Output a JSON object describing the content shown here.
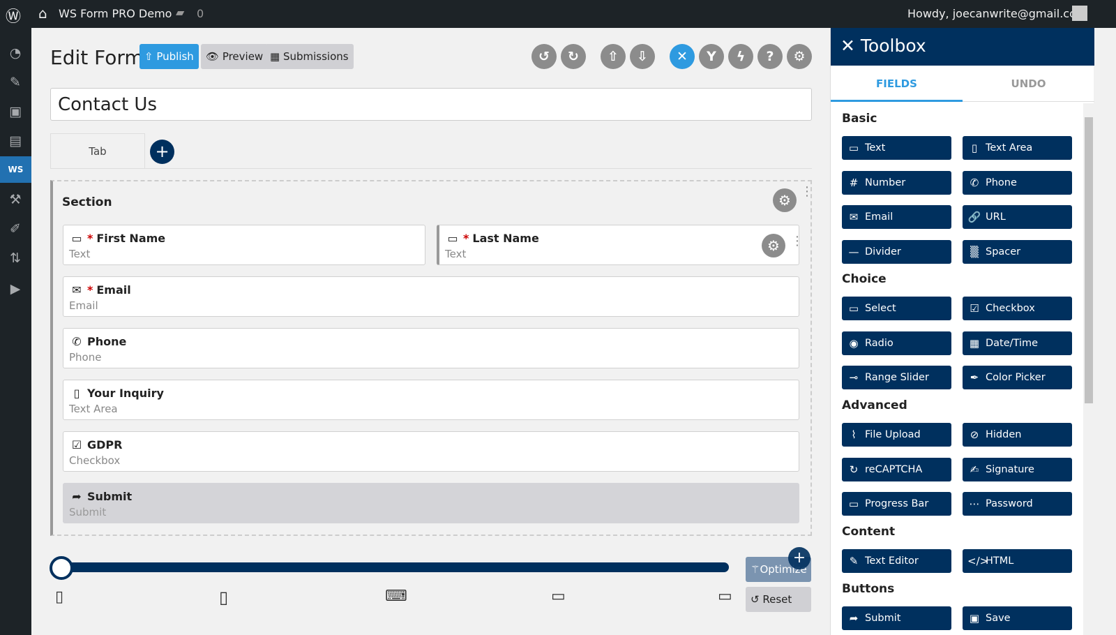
{
  "topbar": {
    "site": "WS Form PRO Demo",
    "comments": "0",
    "howdy": "Howdy, joecanwrite@gmail.com"
  },
  "sidebar": {
    "active_label": "WS"
  },
  "header": {
    "title": "Edit Form",
    "publish": "Publish",
    "preview": "Preview",
    "submissions": "Submissions"
  },
  "toolbar_icons": [
    "undo-icon",
    "redo-icon",
    "upload-icon",
    "download-icon",
    "tools-icon",
    "fork-icon",
    "bolt-icon",
    "help-icon",
    "gear-icon"
  ],
  "form": {
    "name": "Contact Us",
    "tab": "Tab",
    "section": "Section",
    "fields": [
      {
        "label": "First Name",
        "type": "Text",
        "required": true
      },
      {
        "label": "Last Name",
        "type": "Text",
        "required": true
      },
      {
        "label": "Email",
        "type": "Email",
        "required": true
      },
      {
        "label": "Phone",
        "type": "Phone",
        "required": false
      },
      {
        "label": "Your Inquiry",
        "type": "Text Area",
        "required": false
      },
      {
        "label": "GDPR",
        "type": "Checkbox",
        "required": false
      },
      {
        "label": "Submit",
        "type": "Submit",
        "required": false
      }
    ]
  },
  "breakpoints": {
    "slider_value": 0,
    "optimize": "Optimize",
    "reset": "Reset"
  },
  "toolbox": {
    "title": "Toolbox",
    "tabs": [
      "FIELDS",
      "UNDO"
    ],
    "active_tab": "FIELDS",
    "groups": [
      {
        "name": "Basic",
        "items": [
          "Text",
          "Text Area",
          "Number",
          "Phone",
          "Email",
          "URL",
          "Divider",
          "Spacer"
        ]
      },
      {
        "name": "Choice",
        "items": [
          "Select",
          "Checkbox",
          "Radio",
          "Date/Time",
          "Range Slider",
          "Color Picker"
        ]
      },
      {
        "name": "Advanced",
        "items": [
          "File Upload",
          "Hidden",
          "reCAPTCHA",
          "Signature",
          "Progress Bar",
          "Password"
        ]
      },
      {
        "name": "Content",
        "items": [
          "Text Editor",
          "HTML"
        ]
      },
      {
        "name": "Buttons",
        "items": [
          "Submit",
          "Save"
        ]
      }
    ]
  },
  "colors": {
    "navy": "#00305e",
    "accent": "#2e9ae0",
    "adminbar": "#1d2327"
  }
}
